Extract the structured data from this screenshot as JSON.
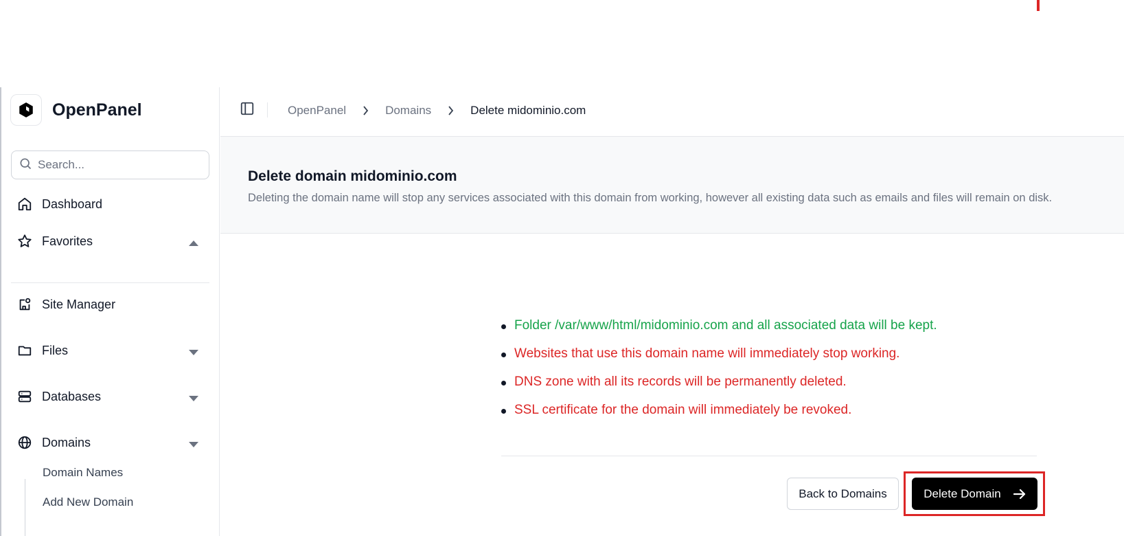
{
  "brand": {
    "name": "OpenPanel"
  },
  "search": {
    "placeholder": "Search..."
  },
  "sidebar": {
    "items": [
      {
        "label": "Dashboard",
        "icon": "home-icon"
      },
      {
        "label": "Favorites",
        "icon": "star-icon",
        "caret": "up"
      },
      {
        "label": "Site Manager",
        "icon": "site-manager-icon"
      },
      {
        "label": "Files",
        "icon": "folder-icon",
        "caret": "down"
      },
      {
        "label": "Databases",
        "icon": "database-icon",
        "caret": "down"
      },
      {
        "label": "Domains",
        "icon": "globe-icon",
        "caret": "down"
      }
    ],
    "sub_items": [
      "Domain Names",
      "Add New Domain"
    ]
  },
  "breadcrumb": {
    "items": [
      "OpenPanel",
      "Domains"
    ],
    "current": "Delete midominio.com"
  },
  "header": {
    "title": "Delete domain midominio.com",
    "description": "Deleting the domain name will stop any services associated with this domain from working, however all existing data such as emails and files will remain on disk."
  },
  "notices": [
    {
      "text": "Folder /var/www/html/midominio.com and all associated data will be kept.",
      "status": "kept"
    },
    {
      "text": "Websites that use this domain name will immediately stop working.",
      "status": "warning"
    },
    {
      "text": "DNS zone with all its records will be permanently deleted.",
      "status": "warning"
    },
    {
      "text": "SSL certificate for the domain will immediately be revoked.",
      "status": "warning"
    }
  ],
  "actions": {
    "back_label": "Back to Domains",
    "delete_label": "Delete Domain"
  },
  "colors": {
    "kept": "#16a34a",
    "warning": "#dc2626",
    "primary_button": "#000000",
    "highlight": "#dc2626"
  }
}
